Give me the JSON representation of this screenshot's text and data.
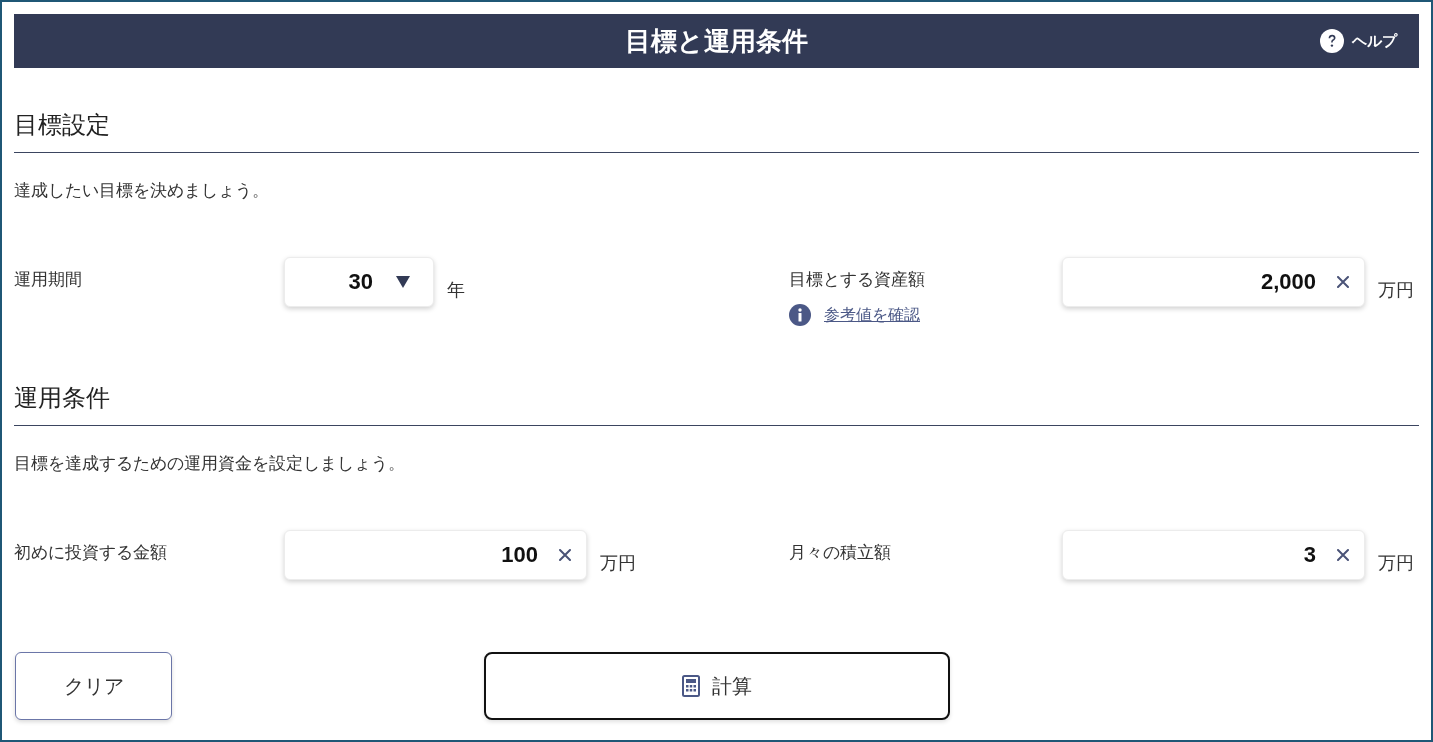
{
  "header": {
    "title": "目標と運用条件",
    "help": "ヘルプ"
  },
  "sections": [
    {
      "heading": "目標設定",
      "description": "達成したい目標を決めましょう。",
      "fields": [
        {
          "kind": "select",
          "label": "運用期間",
          "value": "30",
          "unit": "年"
        },
        {
          "kind": "input",
          "label": "目標とする資産額",
          "value": "2,000",
          "unit": "万円",
          "link": "参考値を確認"
        }
      ]
    },
    {
      "heading": "運用条件",
      "description": "目標を達成するための運用資金を設定しましょう。",
      "fields": [
        {
          "kind": "input",
          "label": "初めに投資する金額",
          "value": "100",
          "unit": "万円"
        },
        {
          "kind": "input",
          "label": "月々の積立額",
          "value": "3",
          "unit": "万円"
        }
      ]
    }
  ],
  "buttons": [
    {
      "kind": "secondary",
      "label": "クリア"
    },
    {
      "kind": "primary",
      "label": "計算"
    }
  ]
}
